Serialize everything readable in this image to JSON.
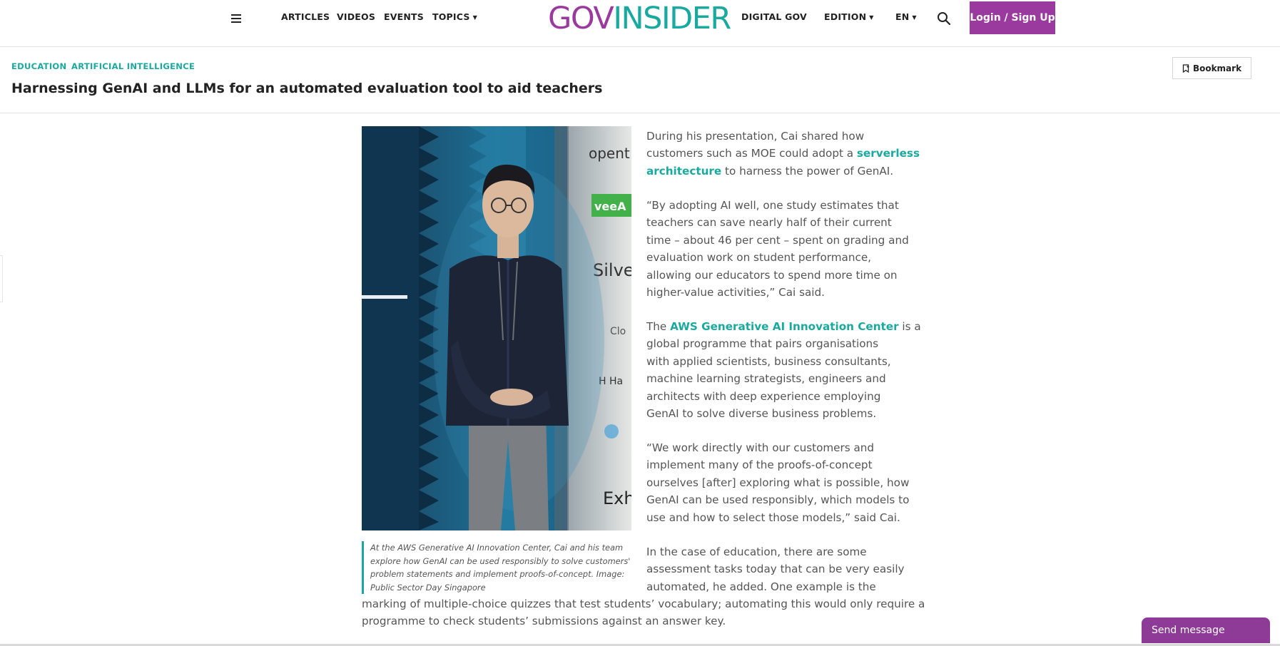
{
  "nav": {
    "menu_icon": "hamburger-menu-icon",
    "links": [
      "ARTICLES",
      "VIDEOS",
      "EVENTS",
      "TOPICS"
    ],
    "logo_part1": "GOV",
    "logo_part2": "INSIDER",
    "digital_gov": "DIGITAL GOV",
    "edition": "EDITION",
    "language": "EN",
    "search_icon": "search-icon",
    "login_label": "Login / Sign Up",
    "colors": {
      "brand_purple": "#9b3a9e",
      "brand_teal": "#1aa99f"
    }
  },
  "article": {
    "tags": [
      "EDUCATION",
      "ARTIFICIAL INTELLIGENCE"
    ],
    "title": "Harnessing GenAI and LLMs for an automated evaluation tool to aid teachers",
    "bookmark_label": "Bookmark",
    "caption_lines": [
      "At the AWS Generative AI Innovation Center, Cai and his team",
      "explore how GenAI can be used responsibly to solve customers'",
      "problem statements and implement proofs-of-concept. Image:",
      "Public Sector Day Singapore"
    ],
    "p1": {
      "line1": "During his presentation, Cai shared how",
      "line2_text": "customers such as MOE could adopt a ",
      "link_part1": "serverless",
      "link_part2": "architecture",
      "line3_text": " to harness the power of GenAI."
    },
    "p2_lines": [
      "“By adopting AI well, one study estimates that",
      "teachers can save nearly half of their current",
      "time – about 46 per cent – spent on grading and",
      "evaluation work on student performance,",
      "allowing our educators to spend more time on",
      "higher-value activities,” Cai said."
    ],
    "p3": {
      "lead": "The ",
      "link": "AWS Generative AI Innovation Center",
      "line1_tail": " is a",
      "lines": [
        "global programme that pairs organisations",
        "with applied scientists, business consultants,",
        "machine learning strategists, engineers and",
        "architects with deep experience employing",
        "GenAI to solve diverse business problems."
      ]
    },
    "p4_lines": [
      "“We work directly with our customers and",
      "implement many of the proofs-of-concept",
      "ourselves [after] exploring what is possible, how",
      "GenAI can be used responsibly, which models to",
      "use and how to select those models,” said Cai."
    ],
    "p5_lines": [
      "In the case of education, there are some",
      "assessment tasks today that can be very easily",
      "automated, he added. One example is the",
      "marking of multiple-choice quizzes that test students’ vocabulary; automating this would only require a",
      "programme to check students’ submissions against an answer key."
    ]
  },
  "chat": {
    "send_label": "Send message"
  }
}
